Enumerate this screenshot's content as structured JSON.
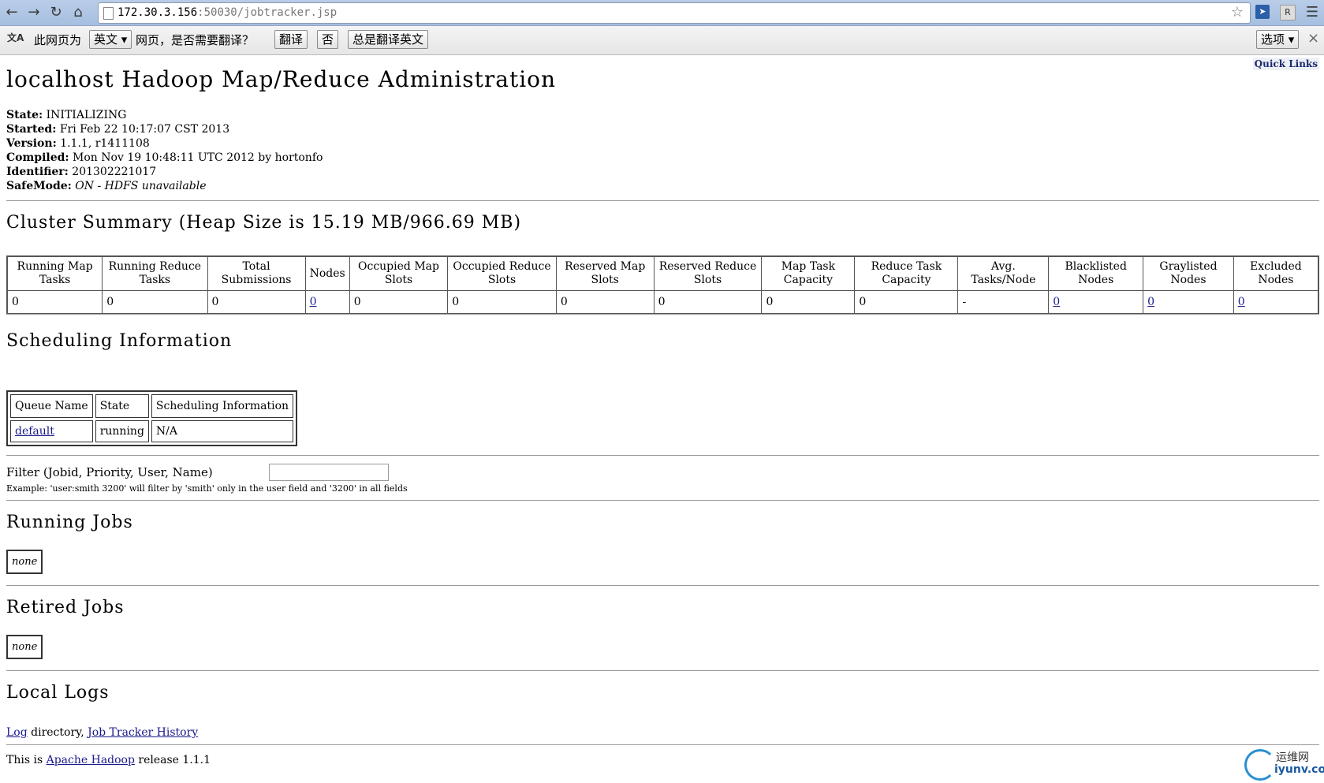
{
  "browser": {
    "url_host": "172.30.3.156",
    "url_rest": ":50030/jobtracker.jsp",
    "ext1": "",
    "ext2": "R"
  },
  "translate_bar": {
    "prefix": "此网页为",
    "language": "英文",
    "suffix": "网页，是否需要翻译？",
    "translate_btn": "翻译",
    "no_btn": "否",
    "always_btn": "总是翻译英文",
    "options_btn": "选项",
    "close": "×"
  },
  "page": {
    "title": "localhost Hadoop Map/Reduce Administration",
    "quick_links": "Quick Links",
    "info": [
      {
        "label": "State:",
        "value": "INITIALIZING"
      },
      {
        "label": "Started:",
        "value": "Fri Feb 22 10:17:07 CST 2013"
      },
      {
        "label": "Version:",
        "value": "1.1.1, r1411108"
      },
      {
        "label": "Compiled:",
        "value": "Mon Nov 19 10:48:11 UTC 2012 by hortonfo"
      },
      {
        "label": "Identifier:",
        "value": "201302221017"
      },
      {
        "label": "SafeMode:",
        "value": "ON - HDFS unavailable"
      }
    ],
    "cluster_summary_heading": "Cluster Summary (Heap Size is 15.19 MB/966.69 MB)",
    "cluster_columns": [
      "Running Map Tasks",
      "Running Reduce Tasks",
      "Total Submissions",
      "Nodes",
      "Occupied Map Slots",
      "Occupied Reduce Slots",
      "Reserved Map Slots",
      "Reserved Reduce Slots",
      "Map Task Capacity",
      "Reduce Task Capacity",
      "Avg. Tasks/Node",
      "Blacklisted Nodes",
      "Graylisted Nodes",
      "Excluded Nodes"
    ],
    "cluster_values": [
      "0",
      "0",
      "0",
      "0",
      "0",
      "0",
      "0",
      "0",
      "0",
      "0",
      "-",
      "0",
      "0",
      "0"
    ],
    "scheduling_heading": "Scheduling Information",
    "sched_columns": [
      "Queue Name",
      "State",
      "Scheduling Information"
    ],
    "sched_row": {
      "queue": "default",
      "state": "running",
      "info": "N/A"
    },
    "filter_label": "Filter (Jobid, Priority, User, Name)",
    "filter_value": "",
    "filter_example": "Example: 'user:smith 3200' will filter by 'smith' only in the user field and '3200' in all fields",
    "running_jobs_heading": "Running Jobs",
    "running_jobs_none": "none",
    "retired_jobs_heading": "Retired Jobs",
    "retired_jobs_none": "none",
    "local_logs_heading": "Local Logs",
    "log_link": "Log",
    "log_directory_text": " directory, ",
    "history_link": "Job Tracker History",
    "footer_prefix": "This is ",
    "footer_link": "Apache Hadoop",
    "footer_suffix": " release 1.1.1"
  },
  "watermark": {
    "cn": "运维网",
    "en": "iyunv.com"
  }
}
